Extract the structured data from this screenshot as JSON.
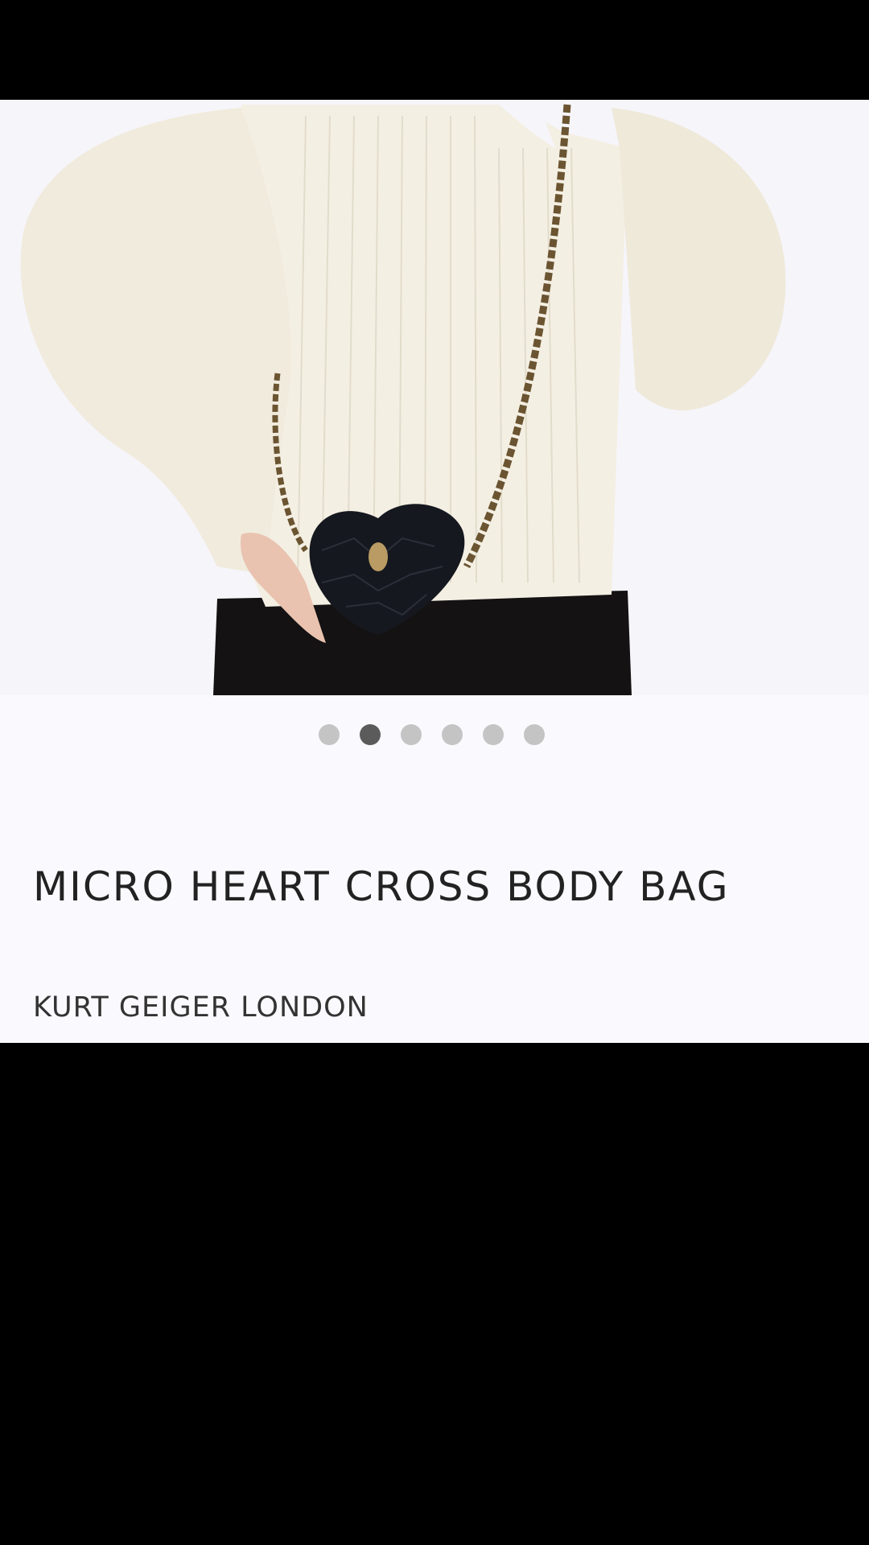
{
  "product": {
    "title": "MICRO HEART CROSS BODY BAG",
    "brand": "KURT GEIGER LONDON",
    "image_icon": "product-photo"
  },
  "carousel": {
    "total": 6,
    "active_index": 1
  },
  "colors": {
    "background": "#faf9fd",
    "dot_inactive": "#c4c4c4",
    "dot_active": "#5b5b5b",
    "title_text": "#222222"
  }
}
